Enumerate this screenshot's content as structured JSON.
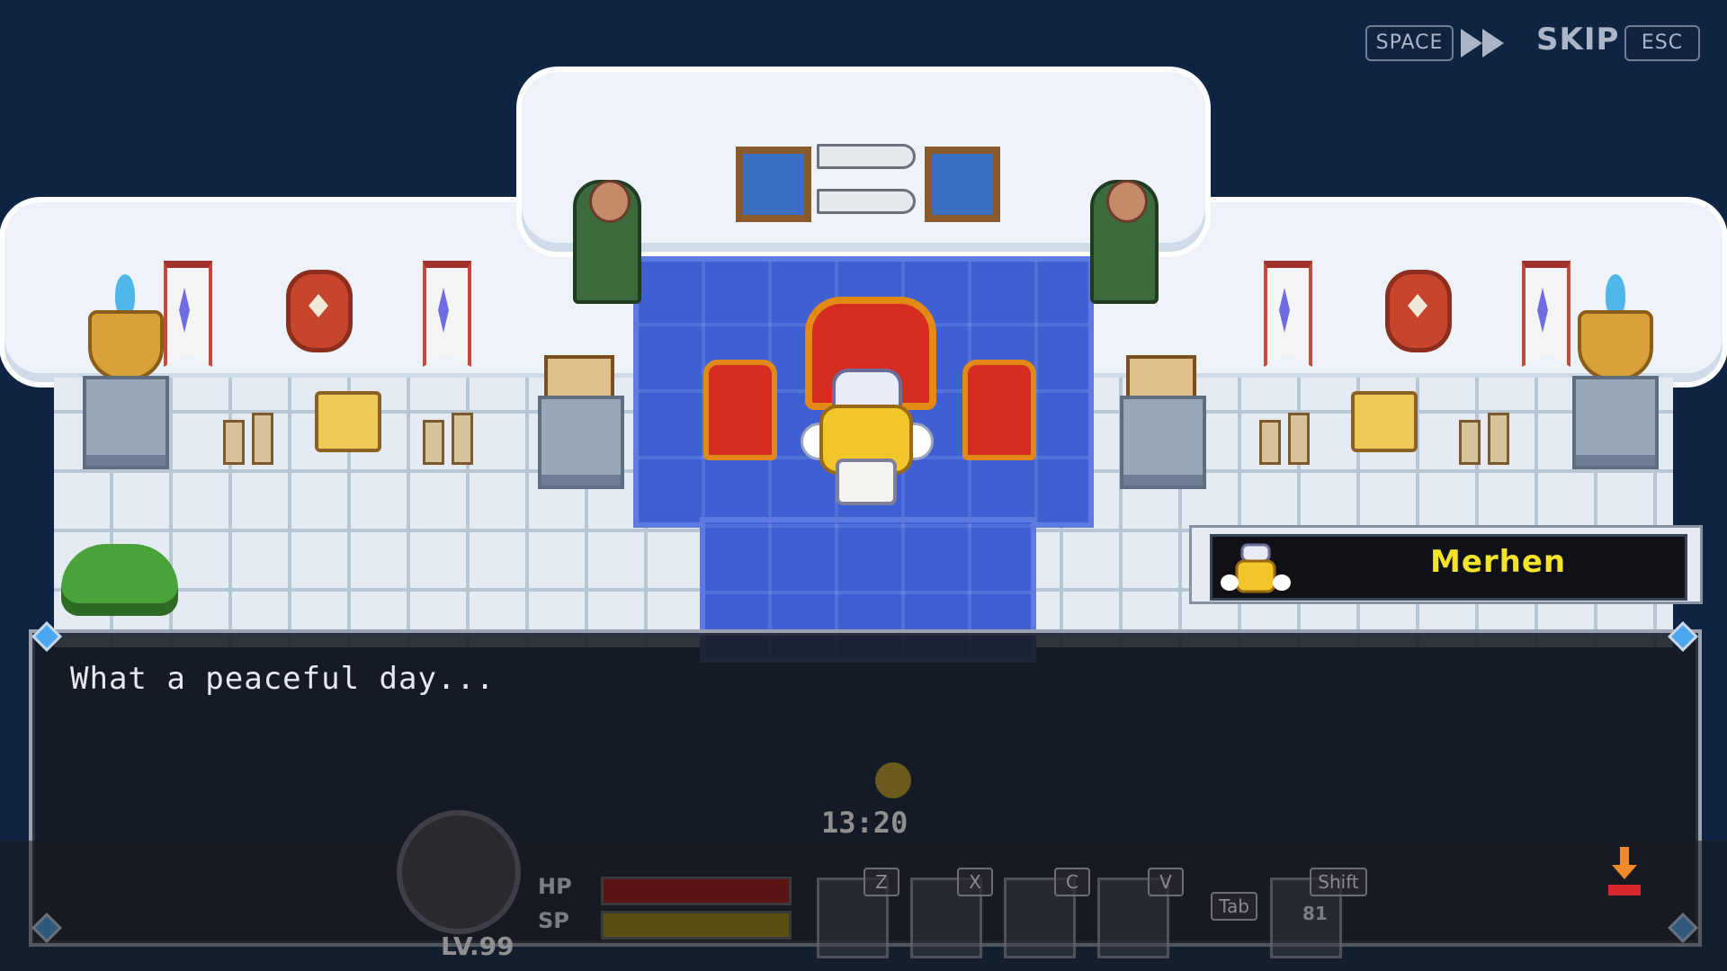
{
  "controls": {
    "space_key": "SPACE",
    "skip_label": "SKIP",
    "esc_key": "ESC"
  },
  "dialogue": {
    "speaker": "Merhen",
    "text": "What a peaceful day..."
  },
  "hud": {
    "clock": "13:20",
    "hp_label": "HP",
    "sp_label": "SP",
    "level": "LV.99",
    "hotkeys": [
      "Z",
      "X",
      "C",
      "V"
    ],
    "tab_key": "Tab",
    "shift_key": "Shift",
    "item_count": "81"
  },
  "colors": {
    "background": "#0f2442",
    "carpet": "#3f5fd2",
    "name_text": "#f4e32a",
    "hp_bar": "#c42222",
    "sp_bar": "#d4b020"
  },
  "icons": [
    "fast-forward-icon",
    "advance-arrow-icon",
    "character-portrait-icon",
    "sun-icon"
  ]
}
